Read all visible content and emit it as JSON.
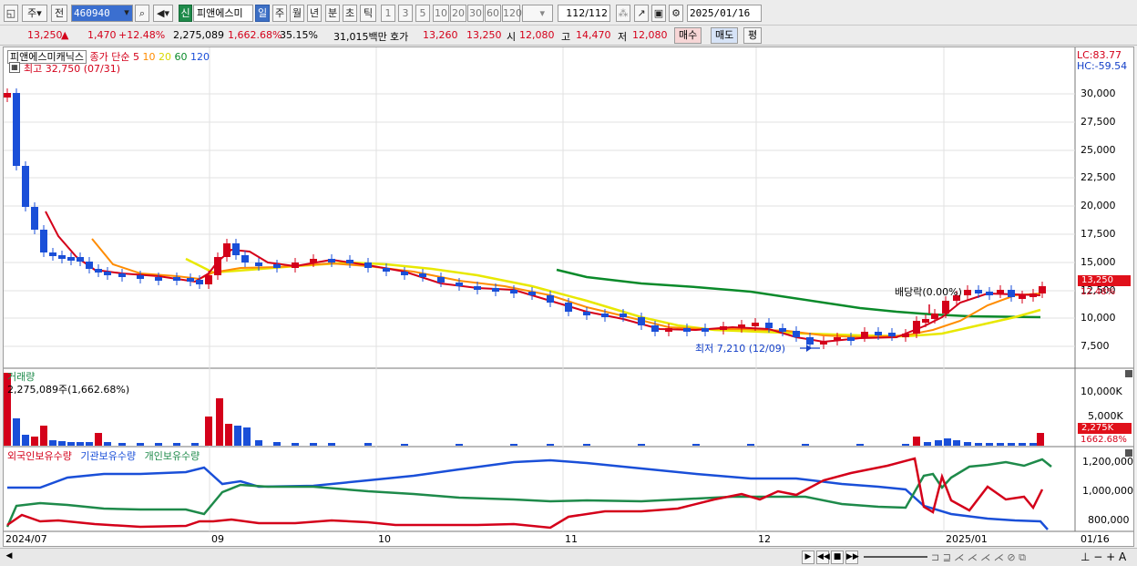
{
  "toolbar": {
    "period_type": "주",
    "prev_label": "전",
    "code": "460940",
    "new_badge": "신",
    "name": "피앤에스미",
    "periods": [
      "일",
      "주",
      "월",
      "년",
      "분",
      "초",
      "틱"
    ],
    "selected_period": "일",
    "intervals": [
      "1",
      "3",
      "5",
      "10",
      "20",
      "30",
      "60",
      "120"
    ],
    "page": "112/112",
    "date": "2025/01/16"
  },
  "quote": {
    "price": "13,250",
    "change": "1,470",
    "change_pct": "+12.48%",
    "volume": "2,275,089",
    "volume_ratio": "1,662.68%",
    "turnover_rate": "35.15%",
    "amount": "31,015백만",
    "hoga_label": "호가",
    "ask": "13,260",
    "bid": "13,250",
    "open_label": "시",
    "open": "12,080",
    "high_label": "고",
    "high": "14,470",
    "low_label": "저",
    "low": "12,080",
    "buy_label": "매수",
    "sell_label": "매도",
    "avg_label": "평"
  },
  "price_panel": {
    "legend_name": "피앤에스미캐닉스",
    "legend_ma": "종가 단순",
    "ma_periods": [
      "5",
      "10",
      "20",
      "60",
      "120"
    ],
    "ma_colors": [
      "#d4001a",
      "#ff8c00",
      "#e8e800",
      "#0a8a2a",
      "#1a4fd8"
    ],
    "high_note": "최고 32,750 (07/31)",
    "low_note": "최저 7,210 (12/09)",
    "event_note": "배당락(0.00%)",
    "lc": "LC:83.77",
    "hc": "HC:-59.54",
    "price_tag": "13,250",
    "pct_tag": "12.48%",
    "y_ticks": [
      "30,000",
      "27,500",
      "25,000",
      "22,500",
      "20,000",
      "17,500",
      "15,000",
      "12,500",
      "10,000",
      "7,500"
    ]
  },
  "volume_panel": {
    "title": "거래량",
    "value": "2,275,089주(1,662.68%)",
    "y_ticks": [
      "10,000K",
      "5,000K"
    ],
    "tag_value": "2,275K",
    "tag_pct": "1662.68%"
  },
  "holding_panel": {
    "series": [
      {
        "name": "외국인보유수량",
        "color": "#d4001a"
      },
      {
        "name": "기관보유수량",
        "color": "#1a4fd8"
      },
      {
        "name": "개인보유수량",
        "color": "#1e8a4a"
      }
    ],
    "y_ticks": [
      "1,200,000",
      "1,000,000",
      "800,000"
    ]
  },
  "x_axis": [
    "2024/07",
    "09",
    "10",
    "11",
    "12",
    "2025/01",
    "01/16"
  ]
}
